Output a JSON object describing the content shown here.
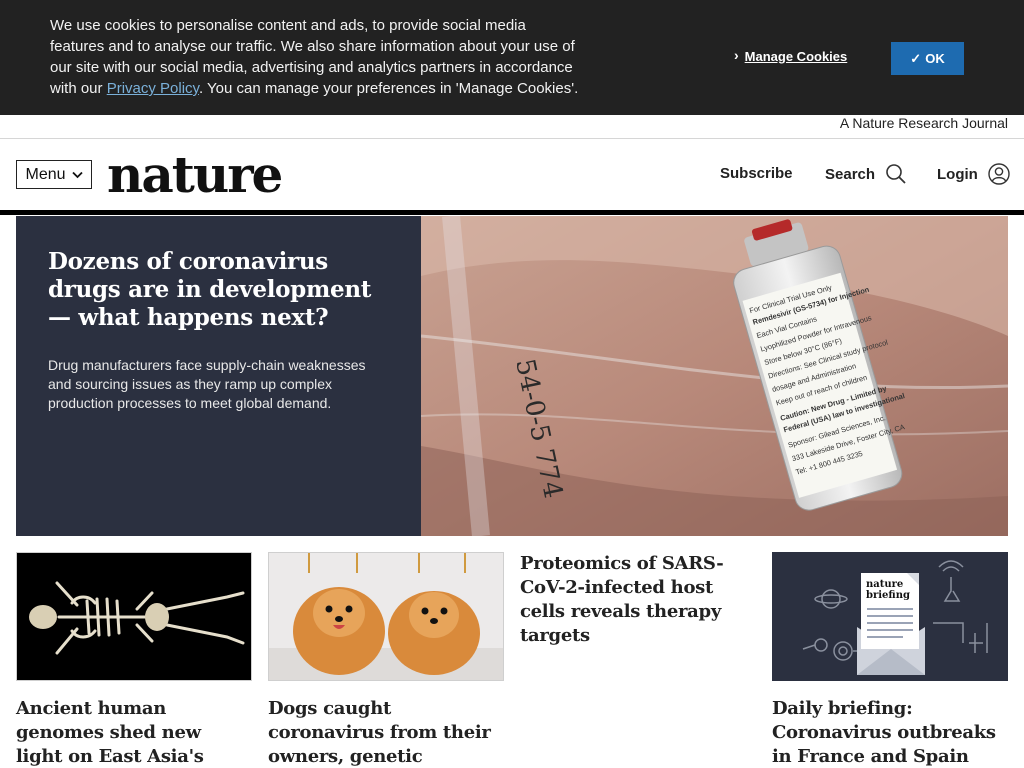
{
  "cookie_banner": {
    "text_before_link": "We use cookies to personalise content and ads, to provide social media features and to analyse our traffic. We also share information about your use of our site with our social media, advertising and analytics partners in accordance with our ",
    "policy_link": "Privacy Policy",
    "text_after_link": ". You can manage your preferences in 'Manage Cookies'.",
    "manage_label": "Manage Cookies",
    "ok_label": "OK"
  },
  "journal_strip": {
    "label": "A Nature Research Journal"
  },
  "header": {
    "menu_label": "Menu",
    "logo": "nature",
    "subscribe_label": "Subscribe",
    "search_label": "Search",
    "login_label": "Login"
  },
  "hero": {
    "title": "Dozens of coronavirus drugs are in development — what happens next?",
    "description": "Drug manufacturers face supply-chain weaknesses and sourcing issues as they ramp up complex production processes to meet global demand.",
    "vial_label_lines": [
      "For Clinical Trial Use Only",
      "Remdesivir (GS-5734) for Injection",
      "Each Vial Contains",
      "Lyophilized Powder for Intravenous",
      "Store below 30°C (86°F)",
      "Directions: See Clinical study protocol",
      "dosage and Administration",
      "Keep out of reach of children",
      "Caution: New Drug - Limited by",
      "Federal (USA) law to investigational",
      "Sponsor: Gilead Sciences, Inc.",
      "333 Lakeside Drive, Foster City, CA",
      "Tel: +1 800 445 3235"
    ],
    "handwriting": "54-0-5 774"
  },
  "cards": [
    {
      "title": "Ancient human genomes shed new light on East Asia's history"
    },
    {
      "title": "Dogs caught coronavirus from their owners, genetic analysis suggests"
    },
    {
      "title": "Proteomics of SARS-CoV-2-infected host cells reveals therapy targets"
    },
    {
      "title": "Daily briefing: Coronavirus outbreaks in France and Spain show",
      "briefing_logo": [
        "nature",
        "briefing"
      ]
    }
  ],
  "colors": {
    "banner_bg": "#222222",
    "ok_button": "#1e6bb0",
    "hero_bg": "#2b3040",
    "briefing_bg": "#2b3040"
  }
}
